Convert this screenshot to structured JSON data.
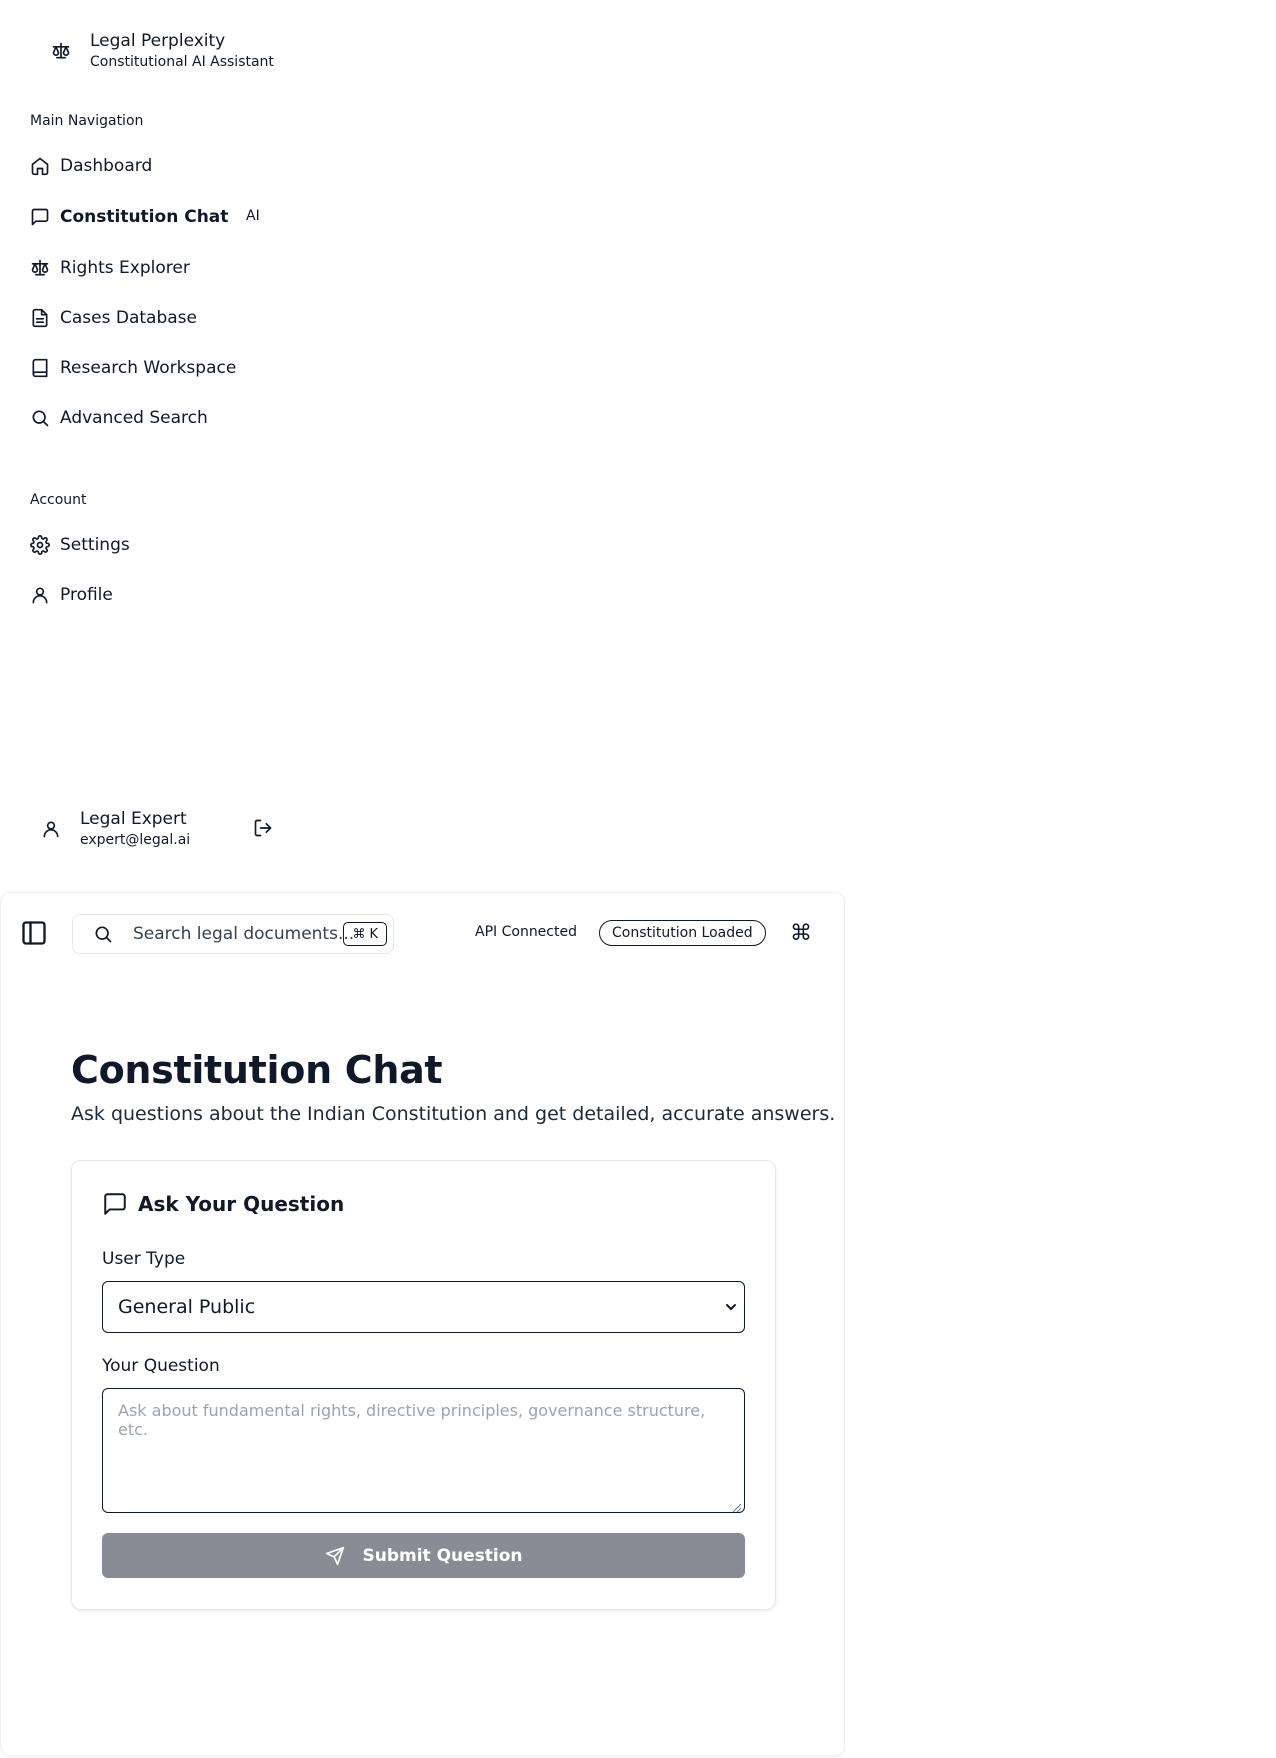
{
  "brand": {
    "title": "Legal Perplexity",
    "subtitle": "Constitutional AI Assistant",
    "icon": "scale-icon"
  },
  "sidebar": {
    "main_label": "Main Navigation",
    "items": [
      {
        "label": "Dashboard",
        "icon": "home-icon"
      },
      {
        "label": "Constitution Chat",
        "icon": "message-icon",
        "badge": "AI",
        "active": true
      },
      {
        "label": "Rights Explorer",
        "icon": "scale-icon"
      },
      {
        "label": "Cases Database",
        "icon": "file-icon"
      },
      {
        "label": "Research Workspace",
        "icon": "book-icon"
      },
      {
        "label": "Advanced Search",
        "icon": "search-icon"
      }
    ],
    "account_label": "Account",
    "account_items": [
      {
        "label": "Settings",
        "icon": "gear-icon"
      },
      {
        "label": "Profile",
        "icon": "user-icon"
      }
    ]
  },
  "user": {
    "name": "Legal Expert",
    "email": "expert@legal.ai"
  },
  "topbar": {
    "search_placeholder": "Search legal documents...",
    "shortcut_symbol": "⌘",
    "shortcut_key": "K",
    "api_status": "API Connected",
    "constitution_status": "Constitution Loaded",
    "command_symbol": "⌘"
  },
  "page": {
    "title": "Constitution Chat",
    "description": "Ask questions about the Indian Constitution and get detailed, accurate answers."
  },
  "form": {
    "card_title": "Ask Your Question",
    "user_type_label": "User Type",
    "user_type_value": "General Public",
    "question_label": "Your Question",
    "question_placeholder": "Ask about fundamental rights, directive principles, governance structure, etc.",
    "submit_label": "Submit Question"
  },
  "colors": {
    "submit_bg": "#898c94",
    "text": "#111827",
    "border": "#e5e7eb"
  }
}
